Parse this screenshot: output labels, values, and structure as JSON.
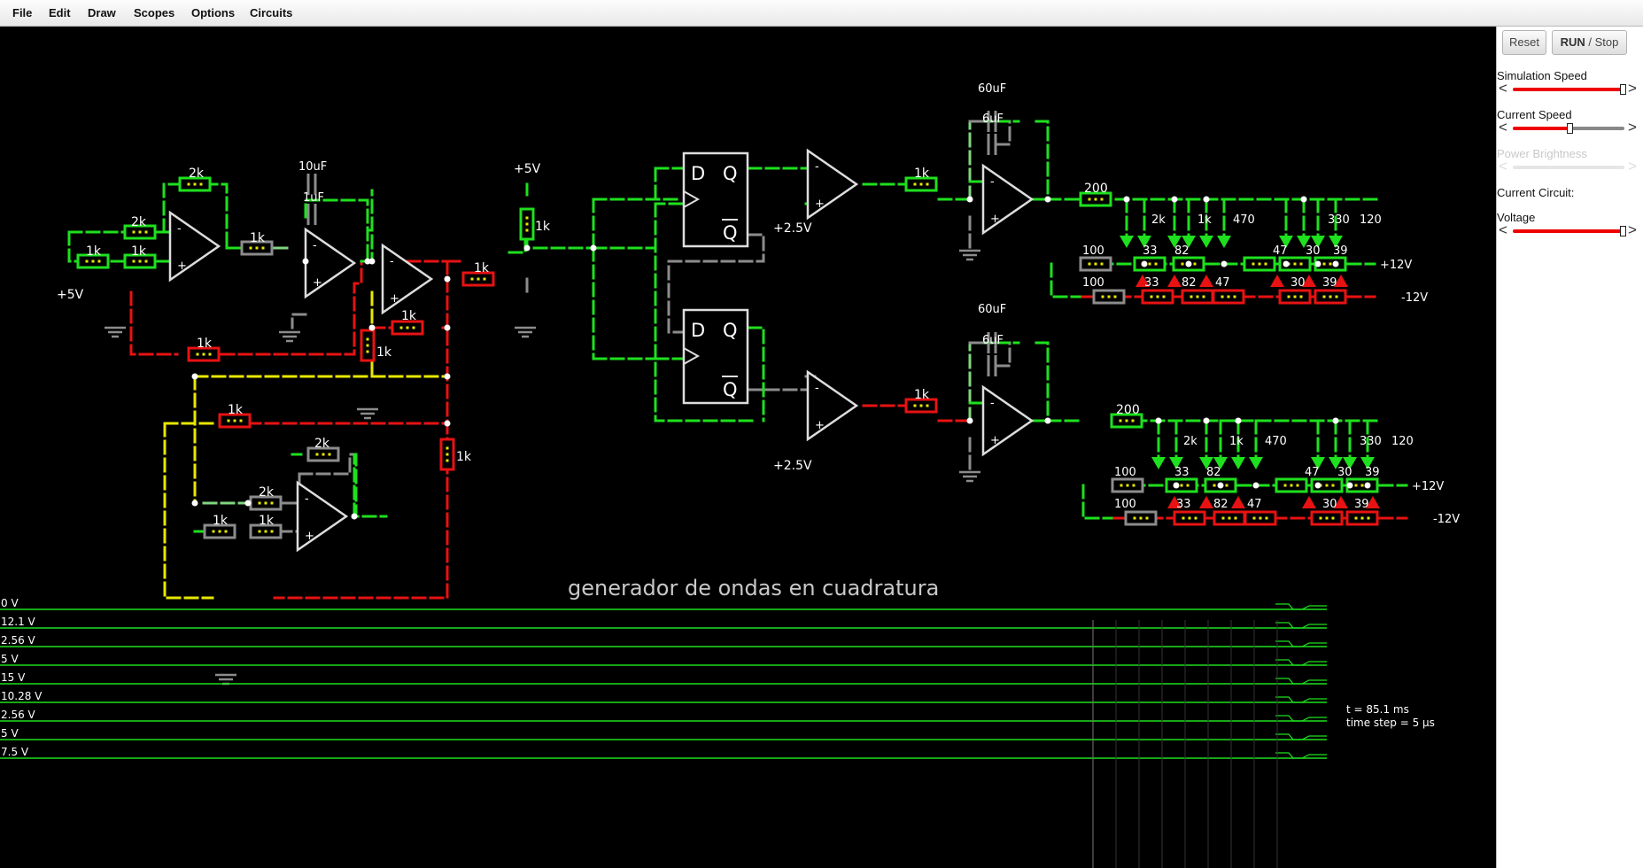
{
  "menu": [
    "File",
    "Edit",
    "Draw",
    "Scopes",
    "Options",
    "Circuits"
  ],
  "sidebar": {
    "reset_label": "Reset",
    "run_label": "RUN",
    "stop_label": " / Stop",
    "sim_speed_label": "Simulation Speed",
    "sim_speed_level": 0.98,
    "current_speed_label": "Current Speed",
    "current_speed_level": 0.5,
    "power_brightness_label": "Power Brightness",
    "current_circuit_label": "Current Circuit:",
    "voltage_label": "Voltage",
    "voltage_level": 0.98
  },
  "circuit": {
    "title": "generador de ondas en cuadratura",
    "labels": {
      "r2k_top": "2k",
      "r2k_a": "2k",
      "r1k_a": "1k",
      "r1k_b": "1k",
      "plus5_left": "+5V",
      "r1k_c": "1k",
      "c10u": "10uF",
      "c1u": "1uF",
      "plus5_mid": "+5V",
      "r1k_d": "1k",
      "r1k_e": "1k",
      "r1k_f": "1k",
      "r1k_g": "1k",
      "r1k_h": "1k",
      "r1k_i": "1k",
      "r2k_b": "2k",
      "r2k_c": "2k",
      "r1k_j": "1k",
      "r1k_k": "1k",
      "r1k_l": "1k",
      "vref_top": "+2.5V",
      "vref_bot": "+2.5V",
      "r1k_top_right": "1k",
      "r1k_bot_right": "1k",
      "c60u_top": "60uF",
      "c6u_top": "6uF",
      "c60u_bot": "60uF",
      "c6u_bot": "6uF",
      "r200_top": "200",
      "r200_bot": "200"
    },
    "ladder_top": {
      "r_up": [
        "2k",
        "1k",
        "470",
        "330",
        "120"
      ],
      "r_mid": [
        "100",
        "33",
        "82",
        "47",
        "30",
        "39"
      ],
      "r_low": [
        "100",
        "33",
        "82",
        "47",
        "30",
        "39"
      ],
      "plus": "+12V",
      "minus": "-12V"
    },
    "ladder_bot": {
      "r_up": [
        "2k",
        "1k",
        "470",
        "330",
        "120"
      ],
      "r_mid": [
        "100",
        "33",
        "82",
        "47",
        "30",
        "39"
      ],
      "r_low": [
        "100",
        "33",
        "82",
        "47",
        "30",
        "39"
      ],
      "plus": "+12V",
      "minus": "-12V"
    }
  },
  "scopes": {
    "labels": [
      "0 V",
      "12.1 V",
      "2.56 V",
      "5 V",
      "15 V",
      "10.28 V",
      "2.56 V",
      "5 V",
      "7.5 V"
    ],
    "time": "t = 85.1 ms",
    "timestep": "time step = 5 µs"
  }
}
